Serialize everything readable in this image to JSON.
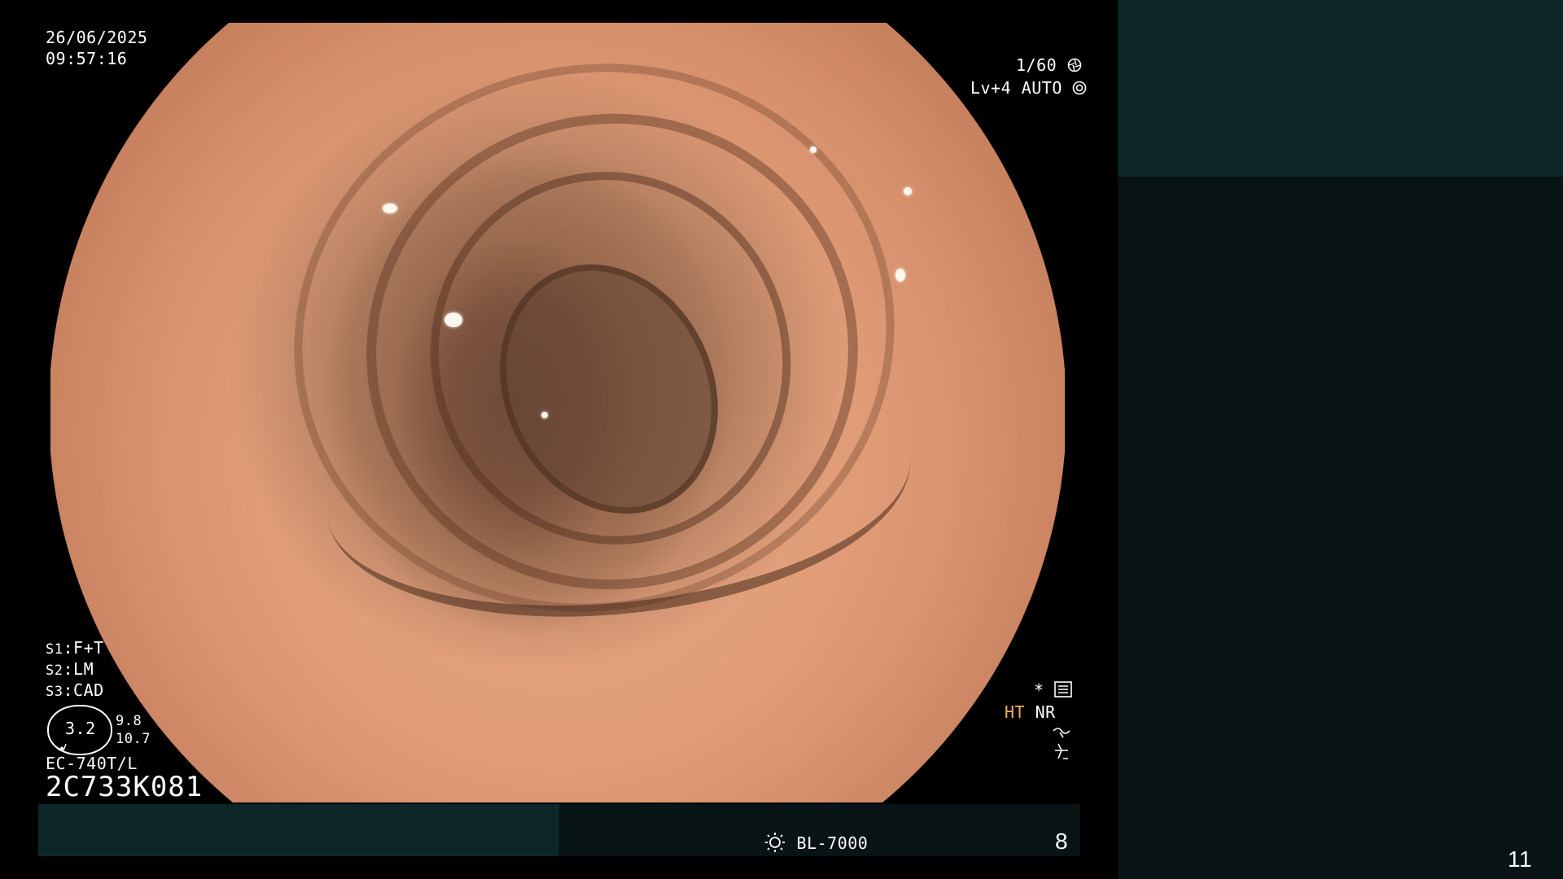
{
  "overlay": {
    "date": "26/06/2025",
    "time": "09:57:16",
    "shutter": "1/60",
    "level": "Lv+4",
    "exposure_mode": "AUTO",
    "settings": [
      {
        "key": "S1",
        "value": "F+T"
      },
      {
        "key": "S2",
        "value": "LM"
      },
      {
        "key": "S3",
        "value": "CAD"
      }
    ],
    "badge_value": "3.2",
    "side_values": [
      "9.8",
      "10.7"
    ],
    "scope_model": "EC-740T/L",
    "serial": "2C733K081",
    "asterisk": "*",
    "ht_label": "HT",
    "nr_label": "NR",
    "light_source": "BL-7000",
    "bottom_number": "8",
    "page_number": "11",
    "colors": {
      "ht_label": "#f0b060",
      "panel_teal": "#0d2628",
      "panel_dark": "#081315"
    },
    "icons": [
      "aperture-icon",
      "iris-icon",
      "menu-list-icon",
      "curve-icon",
      "zigzag-icon",
      "light-bulb-icon",
      "pen-icon"
    ]
  }
}
